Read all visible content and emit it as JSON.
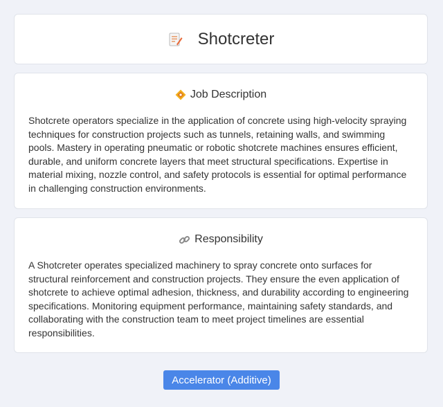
{
  "header": {
    "title": "Shotcreter",
    "icon": "memo-icon"
  },
  "job_description": {
    "icon": "diamond-icon",
    "title": "Job Description",
    "body": "Shotcrete operators specialize in the application of concrete using high-velocity spraying techniques for construction projects such as tunnels, retaining walls, and swimming pools. Mastery in operating pneumatic or robotic shotcrete machines ensures efficient, durable, and uniform concrete layers that meet structural specifications. Expertise in material mixing, nozzle control, and safety protocols is essential for optimal performance in challenging construction environments."
  },
  "responsibility": {
    "icon": "link-icon",
    "title": "Responsibility",
    "body": "A Shotcreter operates specialized machinery to spray concrete onto surfaces for structural reinforcement and construction projects. They ensure the even application of shotcrete to achieve optimal adhesion, thickness, and durability according to engineering specifications. Monitoring equipment performance, maintaining safety standards, and collaborating with the construction team to meet project timelines are essential responsibilities."
  },
  "tag": {
    "label": "Accelerator (Additive)"
  },
  "colors": {
    "accent": "#4a86e8",
    "background": "#f0f2f8"
  }
}
